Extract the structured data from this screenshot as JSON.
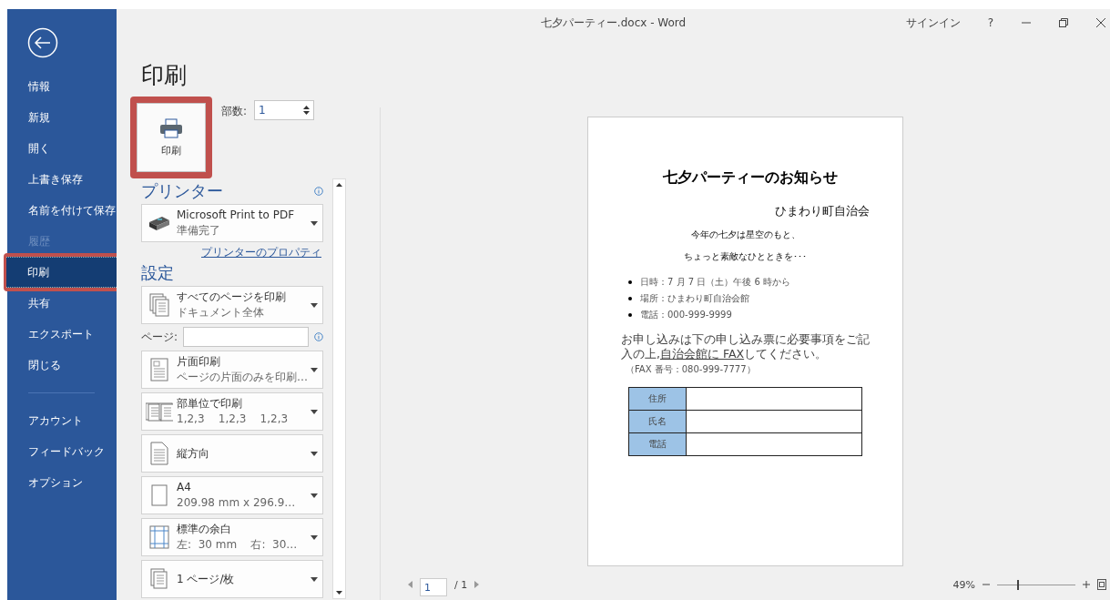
{
  "window": {
    "title": "七夕パーティー.docx - Word",
    "signin": "サインイン",
    "help": "?"
  },
  "sidebar": {
    "items": [
      {
        "label": "情報",
        "selected": false,
        "disabled": false,
        "highlighted": false
      },
      {
        "label": "新規",
        "selected": false,
        "disabled": false,
        "highlighted": false
      },
      {
        "label": "開く",
        "selected": false,
        "disabled": false,
        "highlighted": false
      },
      {
        "label": "上書き保存",
        "selected": false,
        "disabled": false,
        "highlighted": false
      },
      {
        "label": "名前を付けて保存",
        "selected": false,
        "disabled": false,
        "highlighted": false
      },
      {
        "label": "履歴",
        "selected": false,
        "disabled": true,
        "highlighted": false
      },
      {
        "label": "印刷",
        "selected": true,
        "disabled": false,
        "highlighted": true
      },
      {
        "label": "共有",
        "selected": false,
        "disabled": false,
        "highlighted": false
      },
      {
        "label": "エクスポート",
        "selected": false,
        "disabled": false,
        "highlighted": false
      },
      {
        "label": "閉じる",
        "selected": false,
        "disabled": false,
        "highlighted": false
      }
    ],
    "footer_items": [
      {
        "label": "アカウント"
      },
      {
        "label": "フィードバック"
      },
      {
        "label": "オプション"
      }
    ]
  },
  "print": {
    "title": "印刷",
    "button": {
      "label": "印刷",
      "highlighted": true
    },
    "copies_label": "部数:",
    "copies": "1"
  },
  "printer": {
    "heading": "プリンター",
    "name": "Microsoft Print to PDF",
    "status": "準備完了",
    "properties_link": "プリンターのプロパティ"
  },
  "settings": {
    "heading": "設定",
    "pages_label": "ページ:",
    "items": [
      {
        "kind": "pages",
        "title": "すべてのページを印刷",
        "subtitle": "ドキュメント全体"
      },
      {
        "kind": "sides",
        "title": "片面印刷",
        "subtitle": "ページの片面のみを印刷…"
      },
      {
        "kind": "collate",
        "title": "部単位で印刷",
        "subtitle": "1,2,3    1,2,3    1,2,3"
      },
      {
        "kind": "orientation",
        "title": "縦方向"
      },
      {
        "kind": "paper",
        "title": "A4",
        "subtitle": "209.98 mm x 296.9…"
      },
      {
        "kind": "margins",
        "title": "標準の余白",
        "subtitle": "左:  30 mm    右:  30…"
      },
      {
        "kind": "per_sheet",
        "title": "1 ページ/枚"
      }
    ]
  },
  "preview": {
    "document": {
      "title": "七夕パーティーのお知らせ",
      "organizer": "ひまわり町自治会",
      "lines": [
        "今年の七夕は星空のもと、",
        "ちょっと素敵なひとときを･･･"
      ],
      "bullets": [
        "日時：7 月 7 日（土）午後 6 時から",
        "場所：ひまわり町自治会館",
        "電話：000-999-9999"
      ],
      "note": {
        "before": "お申し込みは下の申し込み票に必要事項をご記入の上,",
        "underlined": "自治会館に FAX",
        "after": "してください。"
      },
      "fax": "（FAX 番号：080-999-7777）",
      "form_rows": [
        "住所",
        "氏名",
        "電話"
      ]
    },
    "page": "1",
    "page_total": "/ 1",
    "zoom": "49%",
    "zoom_slider": {
      "level": 0.26
    }
  }
}
